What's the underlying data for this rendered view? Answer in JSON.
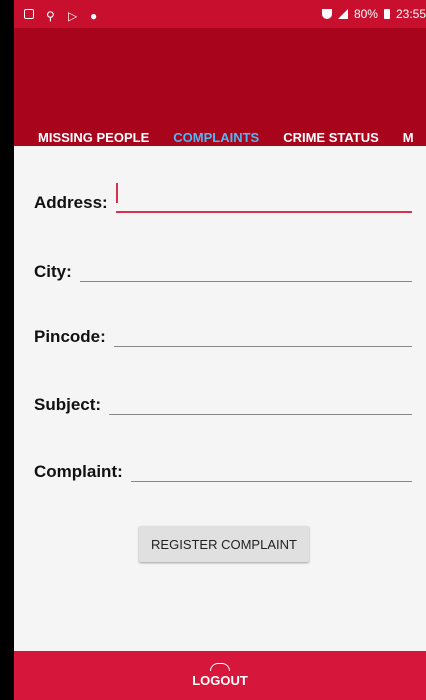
{
  "statusbar": {
    "battery": "80%",
    "time": "23:55"
  },
  "tabs": [
    {
      "label": "MISSING PEOPLE"
    },
    {
      "label": "COMPLAINTS"
    },
    {
      "label": "CRIME STATUS"
    },
    {
      "label": "M"
    }
  ],
  "form": {
    "address_label": "Address:",
    "city_label": "City:",
    "pincode_label": "Pincode:",
    "subject_label": "Subject:",
    "complaint_label": "Complaint:"
  },
  "register_button": "REGISTER COMPLAINT",
  "bottom": {
    "logout": "LOGOUT"
  }
}
